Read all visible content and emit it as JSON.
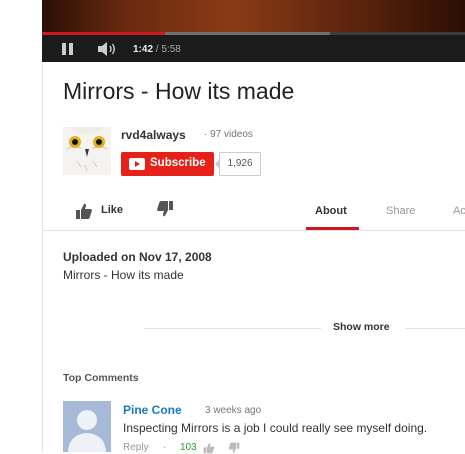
{
  "player": {
    "current_time": "1:42",
    "duration": "/ 5:58",
    "played_fraction": 0.29,
    "buffered_fraction": 0.68
  },
  "video": {
    "title": "Mirrors - How its made"
  },
  "channel": {
    "name": "rvd4always",
    "video_count": "· 97 videos",
    "subscribe_label": "Subscribe",
    "subscriber_count": "1,926"
  },
  "actions": {
    "like_label": "Like"
  },
  "tabs": [
    {
      "label": "About",
      "active": true
    },
    {
      "label": "Share",
      "active": false
    },
    {
      "label": "Ac",
      "active": false
    }
  ],
  "about": {
    "uploaded": "Uploaded on Nov 17, 2008",
    "description": "Mirrors - How its made",
    "show_more": "Show more"
  },
  "comments": {
    "header": "Top Comments",
    "items": [
      {
        "author": "Pine Cone",
        "time": "3 weeks ago",
        "text": "Inspecting Mirrors is a job I could really see myself doing.",
        "reply_label": "Reply",
        "separator": "·",
        "likes": "103"
      }
    ]
  },
  "colors": {
    "accent_red": "#cc181e",
    "subscribe_red": "#e62117",
    "link_blue": "#167ac6",
    "like_green": "#2a9d2a"
  },
  "icons": [
    "pause-icon",
    "volume-icon",
    "thumbs-up-icon",
    "thumbs-down-icon",
    "youtube-logo-icon"
  ]
}
